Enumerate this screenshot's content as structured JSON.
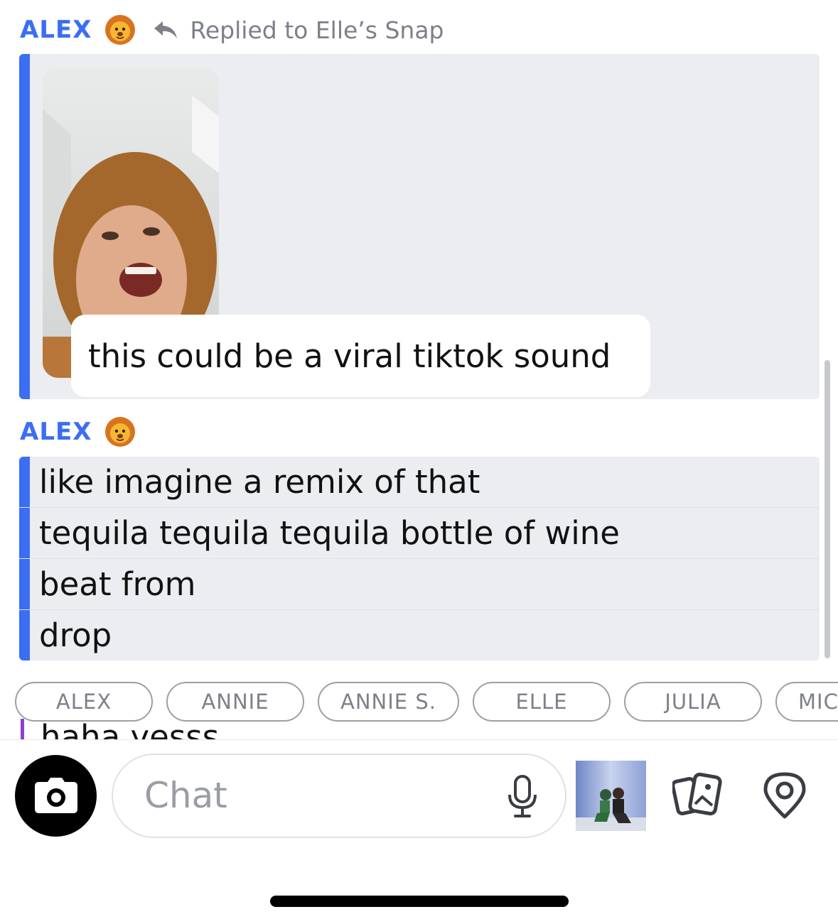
{
  "messages": [
    {
      "sender": "ALEX",
      "sender_color": "#3b6ef3",
      "sender_emoji": "lion-face",
      "reply_label": "Replied to Elle’s Snap",
      "snap_caption": "this could be a viral tiktok sound"
    },
    {
      "sender": "ALEX",
      "sender_color": "#3b6ef3",
      "sender_emoji": "lion-face",
      "lines": [
        "like imagine a remix of that",
        "tequila tequila tequila bottle of wine",
        "beat from",
        "drop"
      ]
    }
  ],
  "mentions": [
    "ALEX",
    "ANNIE",
    "ANNIE S.",
    "ELLE",
    "JULIA",
    "MIC"
  ],
  "peek_text": "haha yesss",
  "peek_color": "#8a3fd8",
  "composer": {
    "placeholder": "Chat",
    "icons": [
      "camera-icon",
      "microphone-icon",
      "bitmoji-sticker",
      "memories-icon",
      "map-pin-icon"
    ]
  }
}
